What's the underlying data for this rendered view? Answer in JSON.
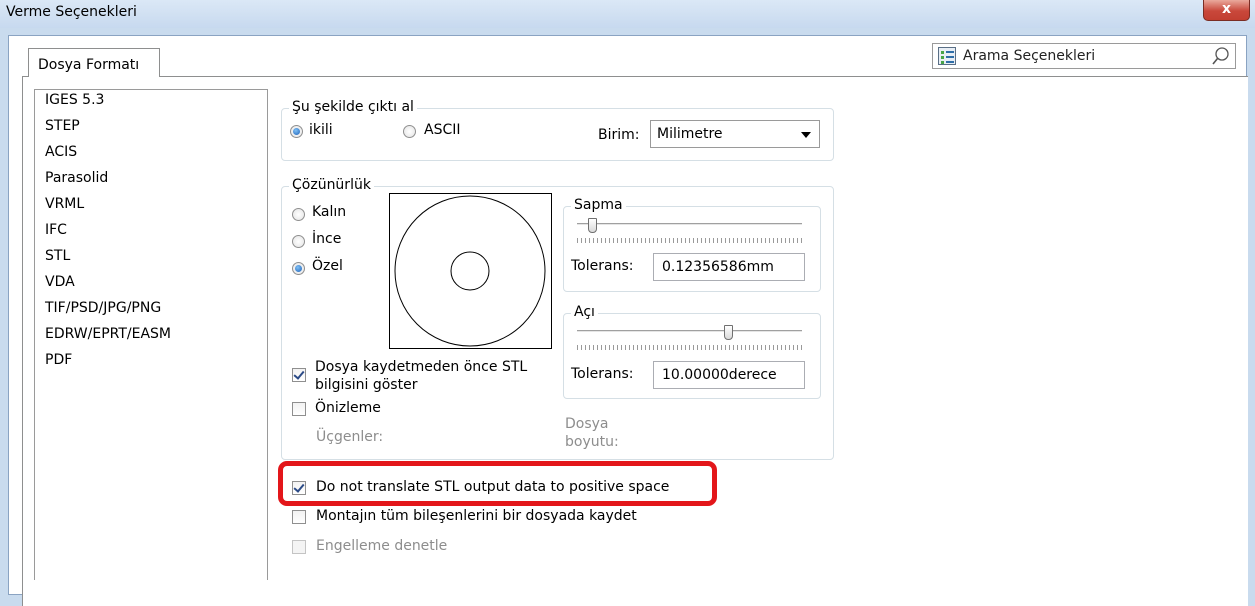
{
  "window": {
    "title": "Verme Seçenekleri",
    "close_label": "x"
  },
  "tab": {
    "label": "Dosya Formatı"
  },
  "search": {
    "placeholder": "Arama Seçenekleri"
  },
  "formats": [
    "IGES 5.3",
    "STEP",
    "ACIS",
    "Parasolid",
    "VRML",
    "IFC",
    "STL",
    "VDA",
    "TIF/PSD/JPG/PNG",
    "EDRW/EPRT/EASM",
    "PDF"
  ],
  "output": {
    "legend": "Şu şekilde çıktı al",
    "binary_label": "ikili",
    "ascii_label": "ASCII",
    "unit_label": "Birim:",
    "unit_value": "Milimetre"
  },
  "resolution": {
    "legend": "Çözünürlük",
    "coarse_label": "Kalın",
    "fine_label": "İnce",
    "custom_label": "Özel",
    "deviation": {
      "legend": "Sapma",
      "tolerance_label": "Tolerans:",
      "tolerance_value": "0.12356586mm",
      "slider_level": 0.05
    },
    "angle": {
      "legend": "Açı",
      "tolerance_label": "Tolerans:",
      "tolerance_value": "10.00000derece",
      "slider_level": 0.68
    },
    "show_info_line1": "Dosya kaydetmeden önce STL",
    "show_info_line2": "bilgisini göster",
    "preview_label": "Önizleme",
    "triangles_label": "Üçgenler:",
    "file_size_line1": "Dosya",
    "file_size_line2": "boyutu:"
  },
  "options": {
    "no_translate_label": "Do not translate STL output data to positive space",
    "save_all_components_label": "Montajın tüm bileşenlerini bir dosyada kaydet",
    "interference_label": "Engelleme denetle"
  },
  "colors": {
    "highlight": "#e3161a",
    "close_button": "#c9483b"
  }
}
